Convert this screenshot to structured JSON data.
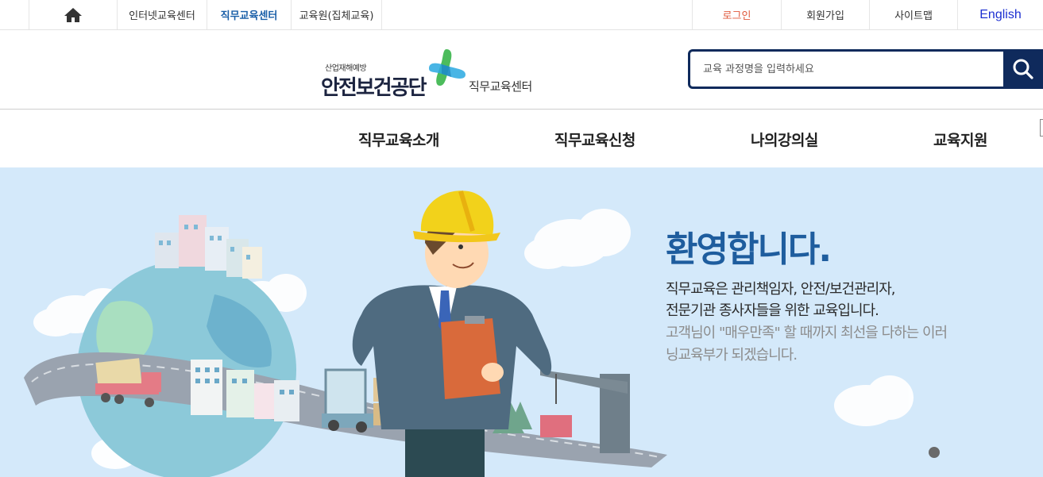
{
  "topbar": {
    "home_icon": "home-icon",
    "links": [
      "인터넷교육센터",
      "직무교육센터",
      "교육원(집체교육)"
    ],
    "login": "로그인",
    "join": "회원가입",
    "sitemap": "사이트맵",
    "english": "English"
  },
  "header": {
    "logo_small": "산업재해예방",
    "logo_big": "안전보건공단",
    "logo_sub": "직무교육센터",
    "search_placeholder": "교육 과정명을 입력하세요",
    "search_icon": "search-icon"
  },
  "nav": {
    "items": [
      "직무교육소개",
      "직무교육신청",
      "나의강의실",
      "교육지원"
    ]
  },
  "hero": {
    "title": "환영합니다.",
    "line1": "직무교육은 관리책임자, 안전/보건관리자,",
    "line2": "전문기관 종사자들을 위한 교육입니다.",
    "line3": "고객님이 \"매우만족\" 할 때까지 최선을 다하는 이러",
    "line4": "닝교육부가 되겠습니다."
  },
  "colors": {
    "accent": "#0f2a5c",
    "active_link": "#1a5fa8",
    "login": "#e0593b",
    "hero_bg": "#d4e9fa",
    "hero_title": "#1e5d9e"
  }
}
